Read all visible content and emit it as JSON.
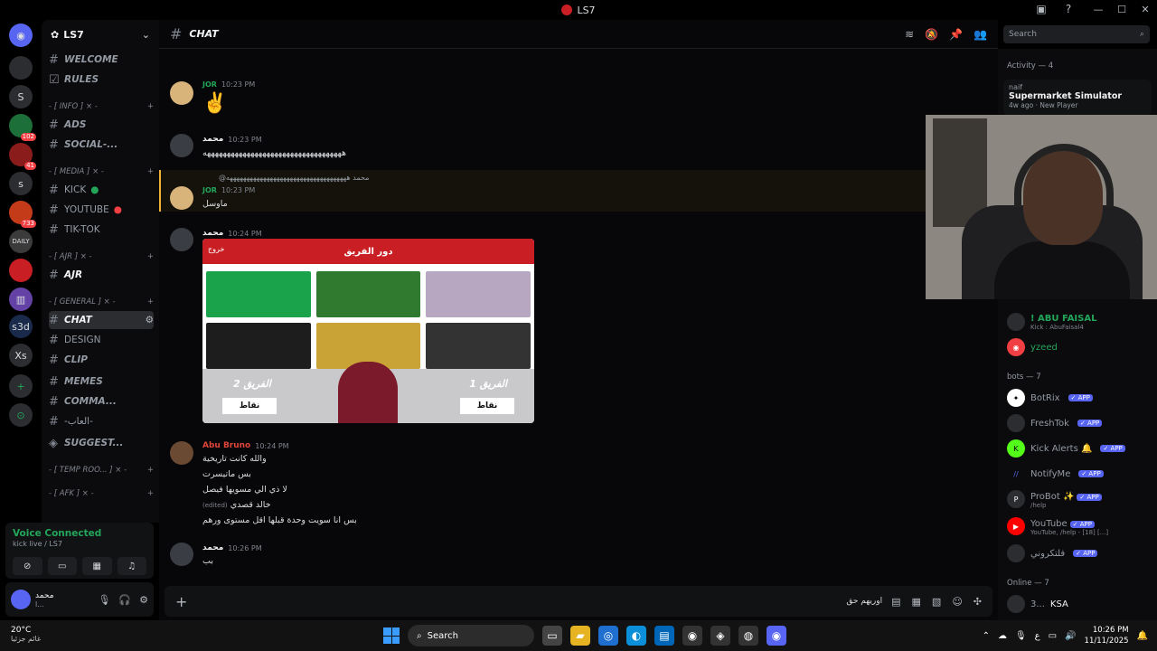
{
  "window": {
    "title": "LS7",
    "controls": [
      "—",
      "☐",
      "✕"
    ]
  },
  "servers": [
    {
      "label": "S"
    },
    {
      "label": "",
      "badge": "102"
    },
    {
      "label": "",
      "badge": "41"
    },
    {
      "label": "s"
    },
    {
      "label": "MT",
      "badge": "733"
    },
    {
      "label": "DAILY"
    },
    {
      "label": ""
    },
    {
      "label": ""
    },
    {
      "label": "s3d"
    },
    {
      "label": "Xs"
    },
    {
      "label": "+"
    },
    {
      "label": "⊙"
    }
  ],
  "sidebar": {
    "guild_name": "LS7",
    "channels": [
      {
        "name": "WELCOME",
        "type": "text"
      },
      {
        "name": "RULES",
        "type": "rules"
      },
      {
        "name": "- [ INFO ] × -",
        "type": "category"
      },
      {
        "name": "ADS",
        "type": "text"
      },
      {
        "name": "SOCIAL-...",
        "type": "text"
      },
      {
        "name": "- [ MEDIA ] × -",
        "type": "category"
      },
      {
        "name": "KICK",
        "type": "plain"
      },
      {
        "name": "YOUTUBE",
        "type": "plain"
      },
      {
        "name": "TIK-TOK",
        "type": "plain"
      },
      {
        "name": "- [ AJR ] × -",
        "type": "category"
      },
      {
        "name": "AJR",
        "type": "text"
      },
      {
        "name": "- [ GENERAL ] × -",
        "type": "category"
      },
      {
        "name": "CHAT",
        "type": "active"
      },
      {
        "name": "DESIGN",
        "type": "plain"
      },
      {
        "name": "CLIP",
        "type": "text"
      },
      {
        "name": "MEMES",
        "type": "text"
      },
      {
        "name": "COMMA...",
        "type": "text"
      },
      {
        "name": "-العاب-",
        "type": "plain"
      },
      {
        "name": "SUGGEST...",
        "type": "text"
      },
      {
        "name": "- [ TEMP ROO... ] × -",
        "type": "category"
      },
      {
        "name": "- [ AFK ] × -",
        "type": "category"
      }
    ]
  },
  "voice": {
    "status": "Voice Connected",
    "channel": "kick live / LS7"
  },
  "user": {
    "name": "محمد",
    "status": "ا..."
  },
  "channel_header": {
    "name": "CHAT"
  },
  "messages": [
    {
      "author": "JOR",
      "time": "10:23 PM",
      "text": "✌️"
    },
    {
      "author": "محمد",
      "time": "10:23 PM",
      "text": "هههههههههههههههههههههههههههههههههههه"
    },
    {
      "author": "JOR",
      "time": "10:23 PM",
      "reply": "@محمد ههههههههههههههههههههههههههههههههههههه",
      "text": "ماوسل"
    },
    {
      "author": "محمد",
      "time": "10:24 PM",
      "text": ""
    },
    {
      "author": "Abu Bruno",
      "time": "10:24 PM",
      "lines": [
        "والله كانت تاريخية",
        "بس ماتيسرت",
        "لا ذي الي مسويها فيصل",
        "خالد قصدي",
        "بس انا سويت وحدة قبلها اقل مستوى ورهم"
      ],
      "edited": "(edited)"
    },
    {
      "author": "محمد",
      "time": "10:26 PM",
      "text": "بب"
    }
  ],
  "attachment": {
    "header": "دور الفريق",
    "exit": "خروج",
    "team1": "الفريق 1",
    "team2": "الفريق 2",
    "points": "نقاط"
  },
  "composer": {
    "value": "اوريهم حق"
  },
  "search": {
    "placeholder": "Search"
  },
  "activity": {
    "label": "Activity — 4",
    "user": "naif",
    "game": "Supermarket Simulator",
    "meta": "4w ago · New Player"
  },
  "members": {
    "online_top": [
      {
        "name": "! ABU FAISAL",
        "sub": "Kick : AbuFaisal4"
      },
      {
        "name": "yzeed",
        "sub": ""
      }
    ],
    "bots_header": "bots — 7",
    "bots": [
      {
        "name": "BotRix",
        "sub": ""
      },
      {
        "name": "FreshTok",
        "sub": ""
      },
      {
        "name": "Kick Alerts 🔔",
        "sub": ""
      },
      {
        "name": "NotifyMe",
        "sub": ""
      },
      {
        "name": "ProBot ✨",
        "sub": "/help"
      },
      {
        "name": "YouTube",
        "sub": "YouTube, /help - [18] [...]"
      },
      {
        "name": "فلتكروني",
        "sub": ""
      }
    ],
    "app_tag": "✓ APP",
    "online_header": "Online — 7",
    "online": [
      {
        "name": "3...",
        "tag": "KSA"
      }
    ]
  },
  "taskbar": {
    "temp": "20°C",
    "weather_desc": "غائم جزئيا",
    "search": "Search",
    "time": "10:26 PM",
    "date": "11/11/2025",
    "lang": "ع"
  }
}
